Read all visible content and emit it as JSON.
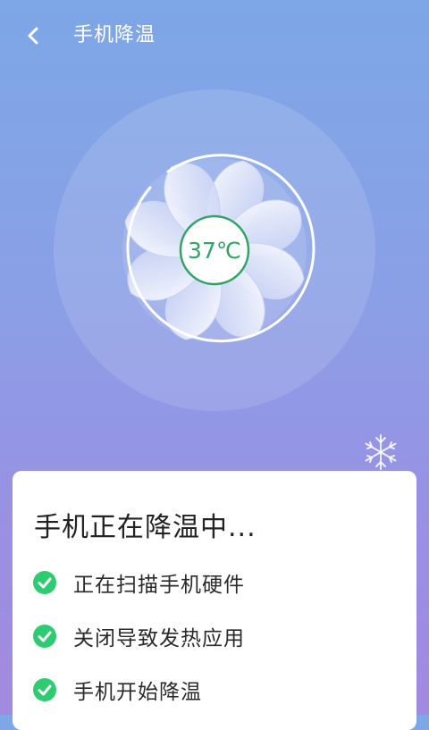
{
  "header": {
    "title": "手机降温",
    "back_icon": "chevron-left-icon"
  },
  "gauge": {
    "temperature": "37℃",
    "temperature_color": "#2fa463"
  },
  "decor": {
    "snowflake_icon": "snowflake-icon"
  },
  "status_card": {
    "heading": "手机正在降温中...",
    "steps": [
      {
        "label": "正在扫描手机硬件",
        "icon": "check-circle-icon"
      },
      {
        "label": "关闭导致发热应用",
        "icon": "check-circle-icon"
      },
      {
        "label": "手机开始降温",
        "icon": "check-circle-icon"
      }
    ],
    "check_color": "#2ecc71"
  }
}
